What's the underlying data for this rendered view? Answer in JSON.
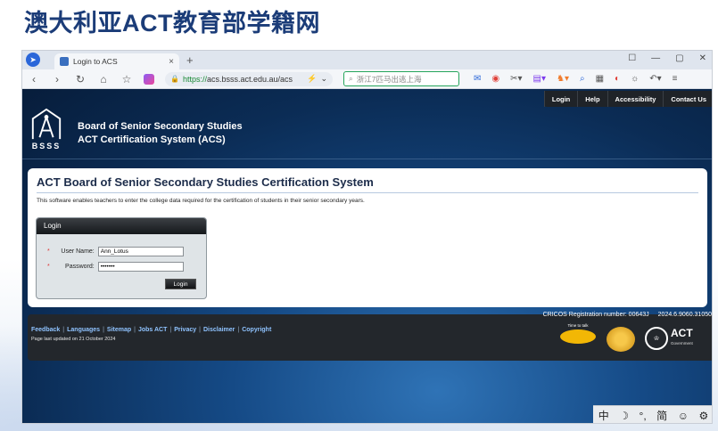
{
  "slide": {
    "title": "澳大利亚ACT教育部学籍网"
  },
  "browser": {
    "tab_title": "Login to ACS",
    "tab_close": "×",
    "new_tab": "+",
    "win_controls": [
      "☐",
      "—",
      "▢",
      "✕"
    ],
    "url_prefix": "https://",
    "url_rest": "acs.bsss.act.edu.au/acs",
    "search_placeholder": "浙江7匹马出逃上海",
    "nav": {
      "back": "‹",
      "forward": "›",
      "reload": "↻",
      "home": "⌂",
      "star": "☆"
    }
  },
  "page": {
    "topnav": [
      "Login",
      "Help",
      "Accessibility",
      "Contact Us"
    ],
    "logo_letters": "BSSS",
    "header_line1": "Board of Senior Secondary Studies",
    "header_line2": "ACT Certification System (ACS)",
    "heading": "ACT Board of Senior Secondary Studies Certification System",
    "description": "This software enables teachers to enter the college data required for the certification of students in their senior secondary years.",
    "login": {
      "title": "Login",
      "username_label": "User Name:",
      "username_value": "Ann_Lotus",
      "password_label": "Password:",
      "password_value": "•••••••",
      "required_mark": "*",
      "button": "Login"
    },
    "footer": {
      "cricos": "CRICOS Registration number: 00643J",
      "version": "2024.6.9060.31050",
      "links": [
        "Feedback",
        "Languages",
        "Sitemap",
        "Jobs ACT",
        "Privacy",
        "Disclaimer",
        "Copyright"
      ],
      "separator": "|",
      "updated": "Page last updated on 21 October 2024",
      "logo_time_caption": "Time to talk",
      "logo_act": "ACT",
      "logo_act_sub": "Government"
    }
  },
  "ime": [
    "中",
    "☽",
    "°,",
    "简",
    "☺",
    "⚙"
  ],
  "colors": {
    "title": "#1b3c78",
    "page_bg": "#0b2c55",
    "link": "#8fc3ff",
    "search_border": "#25a55b"
  }
}
